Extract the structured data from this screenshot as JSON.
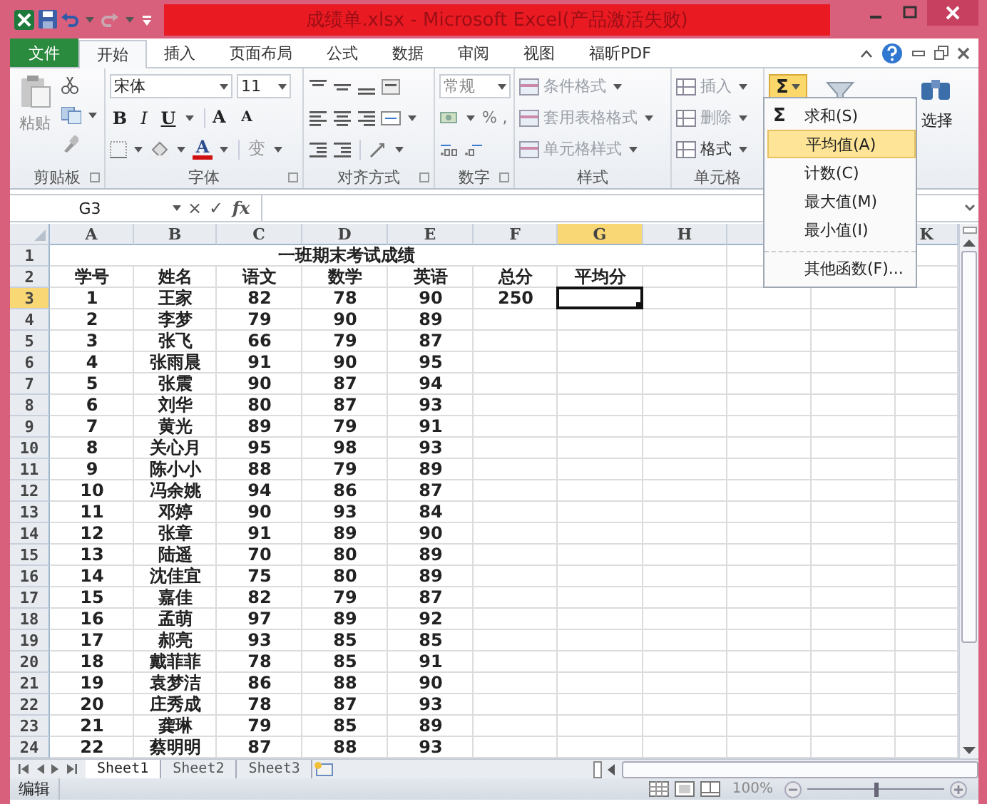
{
  "window": {
    "title": "成绩单.xlsx - Microsoft Excel(产品激活失败)"
  },
  "tabs": [
    {
      "label": "文件",
      "kind": "file",
      "selected": false
    },
    {
      "label": "开始",
      "kind": "tab",
      "selected": true
    },
    {
      "label": "插入",
      "kind": "tab",
      "selected": false
    },
    {
      "label": "页面布局",
      "kind": "tab",
      "selected": false
    },
    {
      "label": "公式",
      "kind": "tab",
      "selected": false
    },
    {
      "label": "数据",
      "kind": "tab",
      "selected": false
    },
    {
      "label": "审阅",
      "kind": "tab",
      "selected": false
    },
    {
      "label": "视图",
      "kind": "tab",
      "selected": false
    },
    {
      "label": "福昕PDF",
      "kind": "tab",
      "selected": false
    }
  ],
  "ribbon": {
    "clipboard": {
      "paste": "粘贴",
      "label": "剪贴板"
    },
    "font": {
      "name": "宋体",
      "size": "11",
      "bold": "B",
      "italic": "I",
      "underline": "U",
      "grow": "A",
      "shrink": "A",
      "font_color": "A",
      "phonetic": "变",
      "label": "字体"
    },
    "alignment": {
      "label": "对齐方式"
    },
    "number": {
      "format": "常规",
      "percent": "%",
      "comma": ",",
      "label": "数字"
    },
    "styles": {
      "items": [
        {
          "label": "条件格式",
          "disabled": true
        },
        {
          "label": "套用表格格式",
          "disabled": true
        },
        {
          "label": "单元格样式",
          "disabled": true
        }
      ],
      "label": "样式"
    },
    "cells": {
      "items": [
        {
          "label": "插入",
          "disabled": true
        },
        {
          "label": "删除",
          "disabled": true
        },
        {
          "label": "格式",
          "disabled": false
        }
      ],
      "label": "单元格"
    },
    "editing": {
      "autosum": {
        "symbol": "Σ",
        "selected": true
      },
      "find_label": "选择"
    }
  },
  "autosum_menu": {
    "symbol": "Σ",
    "items": [
      {
        "label": "求和(S)",
        "selected": false
      },
      {
        "label": "平均值(A)",
        "selected": true
      },
      {
        "label": "计数(C)",
        "selected": false
      },
      {
        "label": "最大值(M)",
        "selected": false
      },
      {
        "label": "最小值(I)",
        "selected": false
      },
      {
        "label": "其他函数(F)...",
        "selected": false,
        "kind": "more"
      }
    ]
  },
  "formula_bar": {
    "name_box": "G3",
    "cancel": "×",
    "enter": "✓",
    "function": "fx"
  },
  "columns": [
    {
      "label": "A",
      "selected": false
    },
    {
      "label": "B",
      "selected": false
    },
    {
      "label": "C",
      "selected": false
    },
    {
      "label": "D",
      "selected": false
    },
    {
      "label": "E",
      "selected": false
    },
    {
      "label": "F",
      "selected": false
    },
    {
      "label": "G",
      "selected": true
    },
    {
      "label": "H",
      "selected": false
    },
    {
      "label": "K",
      "selected": false
    }
  ],
  "rows": [
    {
      "header": "1",
      "kind": "title",
      "text": "一班期末考试成绩",
      "selected": false
    },
    {
      "header": "2",
      "kind": "data",
      "selected": false,
      "cells": [
        "学号",
        "姓名",
        "语文",
        "数学",
        "英语",
        "总分",
        "平均分"
      ]
    },
    {
      "header": "3",
      "kind": "data",
      "selected": true,
      "cells": [
        "1",
        "王家",
        "82",
        "78",
        "90",
        "250"
      ]
    },
    {
      "header": "4",
      "kind": "data",
      "selected": false,
      "cells": [
        "2",
        "李梦",
        "79",
        "90",
        "89"
      ]
    },
    {
      "header": "5",
      "kind": "data",
      "selected": false,
      "cells": [
        "3",
        "张飞",
        "66",
        "79",
        "87"
      ]
    },
    {
      "header": "6",
      "kind": "data",
      "selected": false,
      "cells": [
        "4",
        "张雨晨",
        "91",
        "90",
        "95"
      ]
    },
    {
      "header": "7",
      "kind": "data",
      "selected": false,
      "cells": [
        "5",
        "张震",
        "90",
        "87",
        "94"
      ]
    },
    {
      "header": "8",
      "kind": "data",
      "selected": false,
      "cells": [
        "6",
        "刘华",
        "80",
        "87",
        "93"
      ]
    },
    {
      "header": "9",
      "kind": "data",
      "selected": false,
      "cells": [
        "7",
        "黄光",
        "89",
        "79",
        "91"
      ]
    },
    {
      "header": "10",
      "kind": "data",
      "selected": false,
      "cells": [
        "8",
        "关心月",
        "95",
        "98",
        "93"
      ]
    },
    {
      "header": "11",
      "kind": "data",
      "selected": false,
      "cells": [
        "9",
        "陈小小",
        "88",
        "79",
        "89"
      ]
    },
    {
      "header": "12",
      "kind": "data",
      "selected": false,
      "cells": [
        "10",
        "冯余姚",
        "94",
        "86",
        "87"
      ]
    },
    {
      "header": "13",
      "kind": "data",
      "selected": false,
      "cells": [
        "11",
        "邓婷",
        "90",
        "93",
        "84"
      ]
    },
    {
      "header": "14",
      "kind": "data",
      "selected": false,
      "cells": [
        "12",
        "张章",
        "91",
        "89",
        "90"
      ]
    },
    {
      "header": "15",
      "kind": "data",
      "selected": false,
      "cells": [
        "13",
        "陆遥",
        "70",
        "80",
        "89"
      ]
    },
    {
      "header": "16",
      "kind": "data",
      "selected": false,
      "cells": [
        "14",
        "沈佳宜",
        "75",
        "80",
        "89"
      ]
    },
    {
      "header": "17",
      "kind": "data",
      "selected": false,
      "cells": [
        "15",
        "嘉佳",
        "82",
        "79",
        "87"
      ]
    },
    {
      "header": "18",
      "kind": "data",
      "selected": false,
      "cells": [
        "16",
        "孟萌",
        "97",
        "89",
        "92"
      ]
    },
    {
      "header": "19",
      "kind": "data",
      "selected": false,
      "cells": [
        "17",
        "郝亮",
        "93",
        "85",
        "85"
      ]
    },
    {
      "header": "20",
      "kind": "data",
      "selected": false,
      "cells": [
        "18",
        "戴菲菲",
        "78",
        "85",
        "91"
      ]
    },
    {
      "header": "21",
      "kind": "data",
      "selected": false,
      "cells": [
        "19",
        "袁梦洁",
        "86",
        "88",
        "90"
      ]
    },
    {
      "header": "22",
      "kind": "data",
      "selected": false,
      "cells": [
        "20",
        "庄秀成",
        "78",
        "87",
        "93"
      ]
    },
    {
      "header": "23",
      "kind": "data",
      "selected": false,
      "cells": [
        "21",
        "龚琳",
        "79",
        "85",
        "89"
      ]
    },
    {
      "header": "24",
      "kind": "data",
      "selected": false,
      "cells": [
        "22",
        "蔡明明",
        "87",
        "88",
        "93"
      ]
    }
  ],
  "sheets": [
    {
      "label": "Sheet1",
      "selected": true
    },
    {
      "label": "Sheet2",
      "selected": false
    },
    {
      "label": "Sheet3",
      "selected": false
    }
  ],
  "status_bar": {
    "mode": "编辑",
    "zoom": "100%",
    "zoom_slider": {
      "level": 0.5
    }
  }
}
